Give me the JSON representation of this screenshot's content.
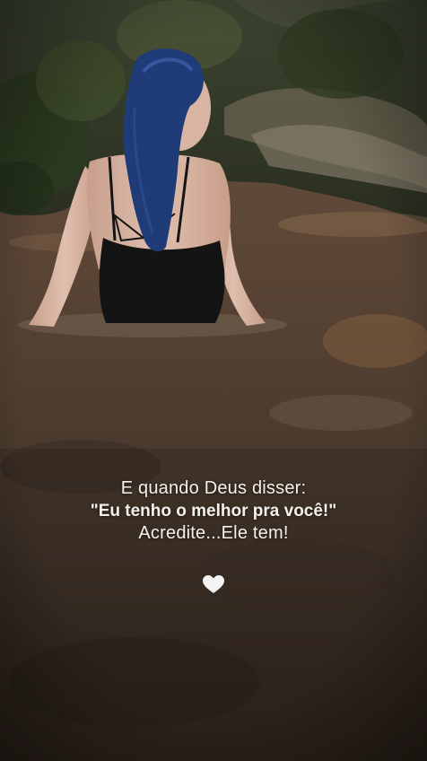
{
  "story": {
    "caption": {
      "line1": "E quando Deus disser:",
      "line2": "\"Eu tenho o melhor pra você!\"",
      "line3": "Acredite...Ele tem!"
    },
    "sticker_icon": "white-heart-icon",
    "colors": {
      "text": "#f4f1ec",
      "water": "#4a3a2c",
      "foliage": "#2f3a22",
      "swimsuit": "#141414",
      "hair": "#1f3b78"
    }
  }
}
